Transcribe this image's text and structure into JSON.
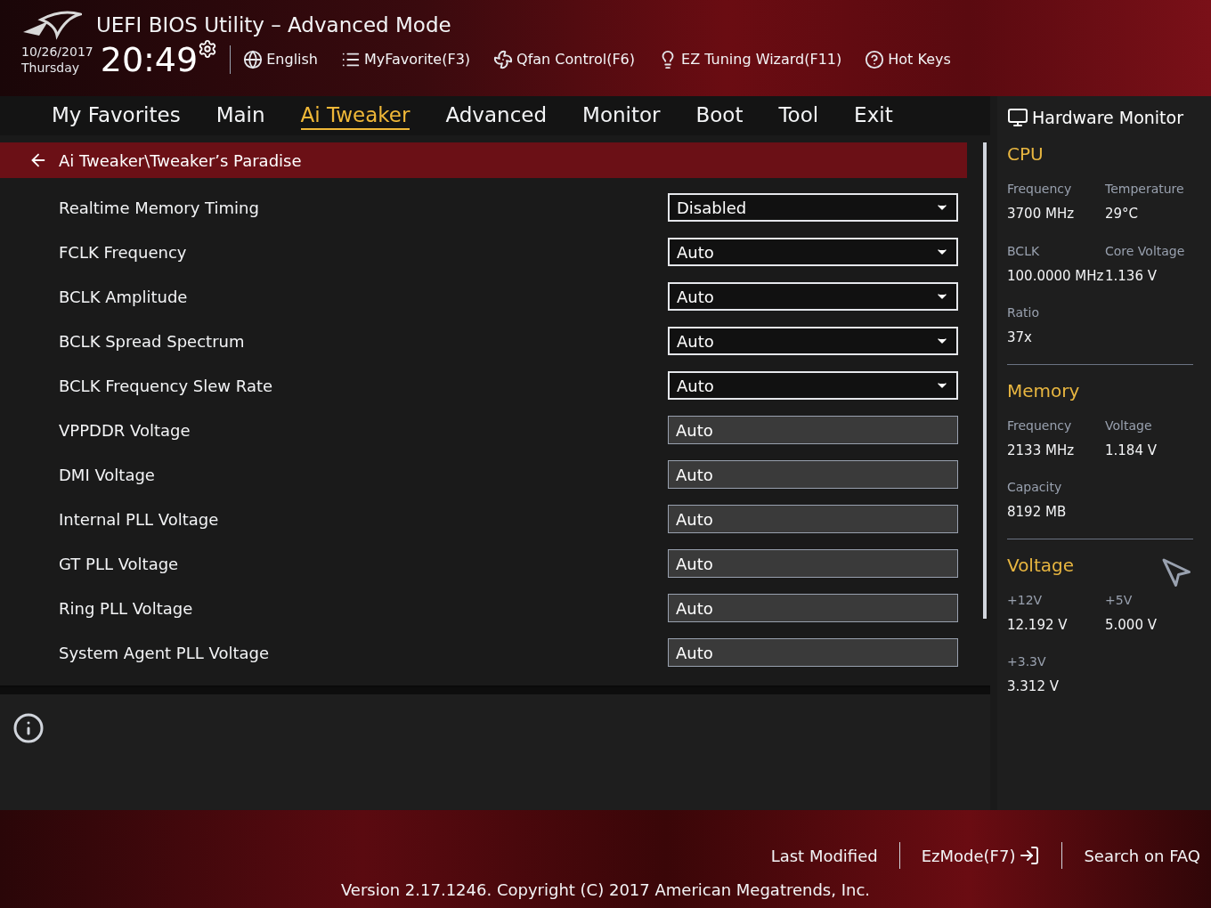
{
  "header": {
    "title": "UEFI BIOS Utility – Advanced Mode",
    "date": "10/26/2017",
    "day": "Thursday",
    "time": "20:49",
    "tools": [
      {
        "kind": "language",
        "label": "English"
      },
      {
        "kind": "favorite",
        "label": "MyFavorite(F3)"
      },
      {
        "kind": "fan",
        "label": "Qfan Control(F6)"
      },
      {
        "kind": "wizard",
        "label": "EZ Tuning Wizard(F11)"
      },
      {
        "kind": "help",
        "label": "Hot Keys"
      }
    ]
  },
  "tabs": [
    {
      "label": "My Favorites",
      "selected": false
    },
    {
      "label": "Main",
      "selected": false
    },
    {
      "label": "Ai Tweaker",
      "selected": true
    },
    {
      "label": "Advanced",
      "selected": false
    },
    {
      "label": "Monitor",
      "selected": false
    },
    {
      "label": "Boot",
      "selected": false
    },
    {
      "label": "Tool",
      "selected": false
    },
    {
      "label": "Exit",
      "selected": false
    }
  ],
  "breadcrumb": "Ai Tweaker\\Tweaker’s Paradise",
  "settings": [
    {
      "label": "Realtime Memory Timing",
      "kind": "dropdown",
      "value": "Disabled"
    },
    {
      "label": "FCLK Frequency",
      "kind": "dropdown",
      "value": "Auto"
    },
    {
      "label": "BCLK Amplitude",
      "kind": "dropdown",
      "value": "Auto"
    },
    {
      "label": "BCLK Spread Spectrum",
      "kind": "dropdown",
      "value": "Auto"
    },
    {
      "label": "BCLK Frequency Slew Rate",
      "kind": "dropdown",
      "value": "Auto"
    },
    {
      "label": "VPPDDR Voltage",
      "kind": "field",
      "value": "Auto"
    },
    {
      "label": "DMI Voltage",
      "kind": "field",
      "value": "Auto"
    },
    {
      "label": "Internal PLL Voltage",
      "kind": "field",
      "value": "Auto"
    },
    {
      "label": "GT PLL Voltage",
      "kind": "field",
      "value": "Auto"
    },
    {
      "label": "Ring PLL Voltage",
      "kind": "field",
      "value": "Auto"
    },
    {
      "label": "System Agent PLL Voltage",
      "kind": "field",
      "value": "Auto"
    }
  ],
  "hardware_monitor": {
    "title": "Hardware Monitor",
    "sections": [
      {
        "title": "CPU",
        "items": [
          {
            "label": "Frequency",
            "value": "3700 MHz"
          },
          {
            "label": "Temperature",
            "value": "29°C"
          },
          {
            "label": "BCLK",
            "value": "100.0000 MHz"
          },
          {
            "label": "Core Voltage",
            "value": "1.136 V"
          },
          {
            "label": "Ratio",
            "value": "37x"
          }
        ]
      },
      {
        "title": "Memory",
        "items": [
          {
            "label": "Frequency",
            "value": "2133 MHz"
          },
          {
            "label": "Voltage",
            "value": "1.184 V"
          },
          {
            "label": "Capacity",
            "value": "8192 MB"
          }
        ]
      },
      {
        "title": "Voltage",
        "items": [
          {
            "label": "+12V",
            "value": "12.192 V"
          },
          {
            "label": "+5V",
            "value": "5.000 V"
          },
          {
            "label": "+3.3V",
            "value": "3.312 V"
          }
        ]
      }
    ]
  },
  "footer": {
    "links": [
      {
        "kind": "text",
        "label": "Last Modified"
      },
      {
        "kind": "exit",
        "label": "EzMode(F7)"
      },
      {
        "kind": "text",
        "label": "Search on FAQ"
      }
    ],
    "version": "Version 2.17.1246. Copyright (C) 2017 American Megatrends, Inc."
  }
}
